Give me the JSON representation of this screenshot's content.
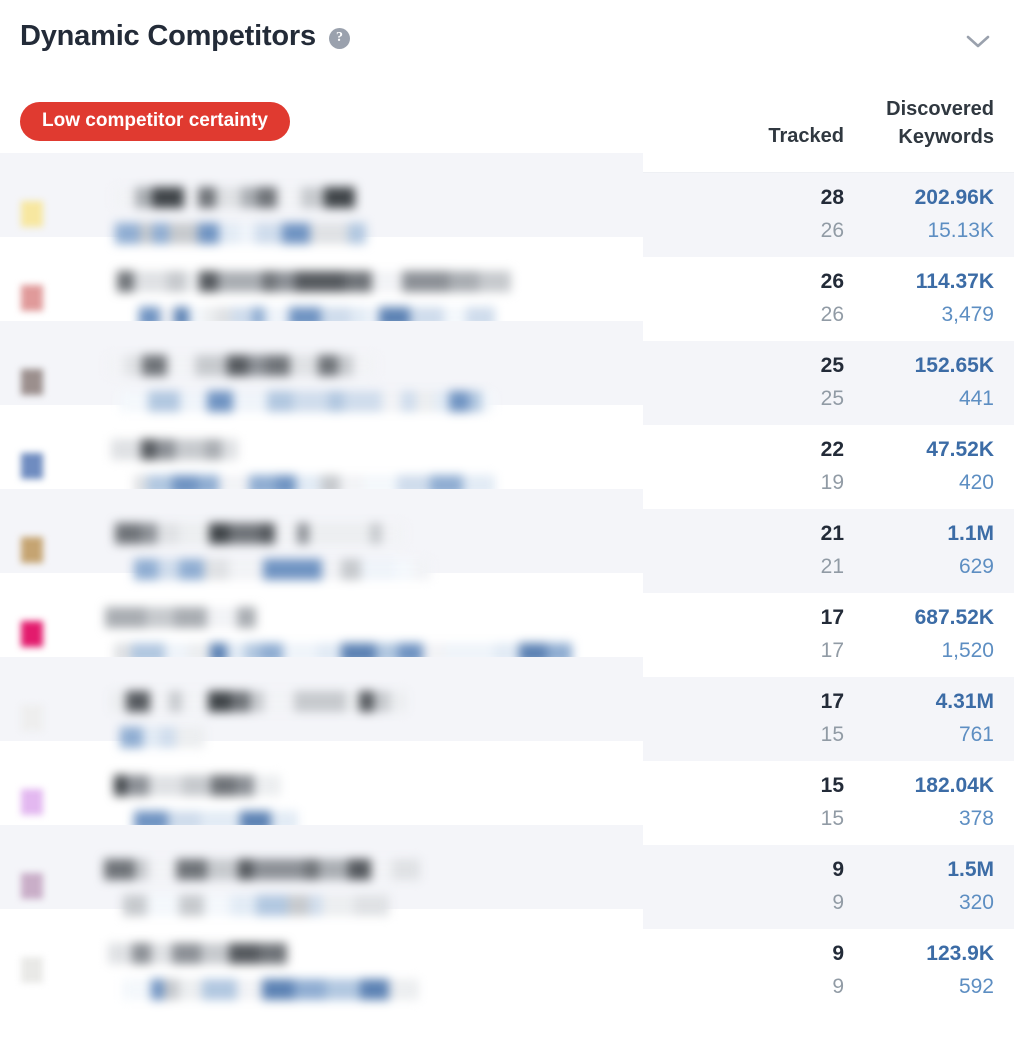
{
  "header": {
    "title": "Dynamic Competitors",
    "help_icon": "question-mark-icon",
    "collapse_icon": "chevron-down-icon"
  },
  "badge": {
    "label": "Low competitor certainty",
    "color": "#e03a30"
  },
  "columns": {
    "tracked": "Tracked",
    "discovered_line1": "Discovered",
    "discovered_line2": "Keywords"
  },
  "theme": {
    "link_color": "#3c6ca6",
    "secondary_text": "#919ba5",
    "stripe_bg": "#f4f5f9"
  },
  "rows": [
    {
      "swatch_color": "#f7e7a0",
      "tracked_primary": "28",
      "tracked_secondary": "26",
      "discovered_primary": "202.96K",
      "discovered_secondary": "15.13K"
    },
    {
      "swatch_color": "#e09a9a",
      "tracked_primary": "26",
      "tracked_secondary": "26",
      "discovered_primary": "114.37K",
      "discovered_secondary": "3,479"
    },
    {
      "swatch_color": "#9b8f8d",
      "tracked_primary": "25",
      "tracked_secondary": "25",
      "discovered_primary": "152.65K",
      "discovered_secondary": "441"
    },
    {
      "swatch_color": "#6f8cc0",
      "tracked_primary": "22",
      "tracked_secondary": "19",
      "discovered_primary": "47.52K",
      "discovered_secondary": "420"
    },
    {
      "swatch_color": "#c5a472",
      "tracked_primary": "21",
      "tracked_secondary": "21",
      "discovered_primary": "1.1M",
      "discovered_secondary": "629"
    },
    {
      "swatch_color": "#e31b6d",
      "tracked_primary": "17",
      "tracked_secondary": "17",
      "discovered_primary": "687.52K",
      "discovered_secondary": "1,520"
    },
    {
      "swatch_color": "#eeeeee",
      "tracked_primary": "17",
      "tracked_secondary": "15",
      "discovered_primary": "4.31M",
      "discovered_secondary": "761"
    },
    {
      "swatch_color": "#e3b8f0",
      "tracked_primary": "15",
      "tracked_secondary": "15",
      "discovered_primary": "182.04K",
      "discovered_secondary": "378"
    },
    {
      "swatch_color": "#c9aec8",
      "tracked_primary": "9",
      "tracked_secondary": "9",
      "discovered_primary": "1.5M",
      "discovered_secondary": "320"
    },
    {
      "swatch_color": "#e9e9e7",
      "tracked_primary": "9",
      "tracked_secondary": "9",
      "discovered_primary": "123.9K",
      "discovered_secondary": "592"
    }
  ]
}
